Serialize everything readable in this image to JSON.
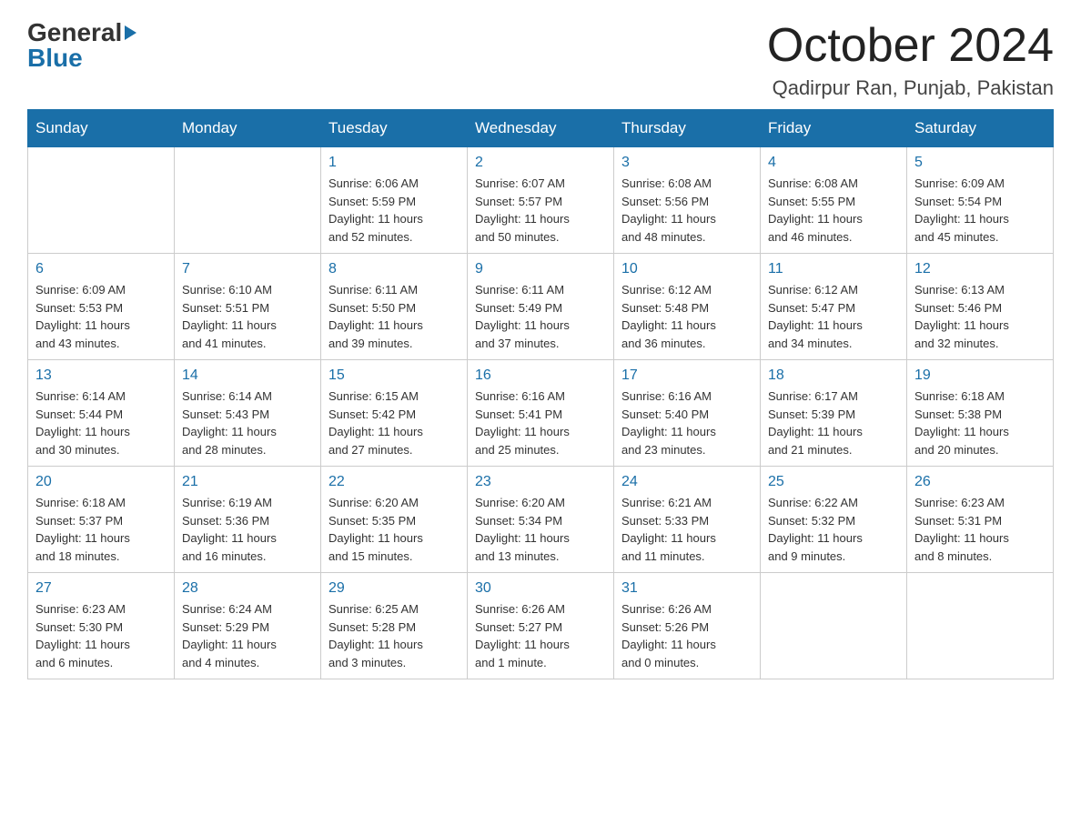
{
  "header": {
    "logo_general": "General",
    "logo_blue": "Blue",
    "month_title": "October 2024",
    "location": "Qadirpur Ran, Punjab, Pakistan"
  },
  "weekdays": [
    "Sunday",
    "Monday",
    "Tuesday",
    "Wednesday",
    "Thursday",
    "Friday",
    "Saturday"
  ],
  "weeks": [
    [
      {
        "day": "",
        "info": ""
      },
      {
        "day": "",
        "info": ""
      },
      {
        "day": "1",
        "info": "Sunrise: 6:06 AM\nSunset: 5:59 PM\nDaylight: 11 hours\nand 52 minutes."
      },
      {
        "day": "2",
        "info": "Sunrise: 6:07 AM\nSunset: 5:57 PM\nDaylight: 11 hours\nand 50 minutes."
      },
      {
        "day": "3",
        "info": "Sunrise: 6:08 AM\nSunset: 5:56 PM\nDaylight: 11 hours\nand 48 minutes."
      },
      {
        "day": "4",
        "info": "Sunrise: 6:08 AM\nSunset: 5:55 PM\nDaylight: 11 hours\nand 46 minutes."
      },
      {
        "day": "5",
        "info": "Sunrise: 6:09 AM\nSunset: 5:54 PM\nDaylight: 11 hours\nand 45 minutes."
      }
    ],
    [
      {
        "day": "6",
        "info": "Sunrise: 6:09 AM\nSunset: 5:53 PM\nDaylight: 11 hours\nand 43 minutes."
      },
      {
        "day": "7",
        "info": "Sunrise: 6:10 AM\nSunset: 5:51 PM\nDaylight: 11 hours\nand 41 minutes."
      },
      {
        "day": "8",
        "info": "Sunrise: 6:11 AM\nSunset: 5:50 PM\nDaylight: 11 hours\nand 39 minutes."
      },
      {
        "day": "9",
        "info": "Sunrise: 6:11 AM\nSunset: 5:49 PM\nDaylight: 11 hours\nand 37 minutes."
      },
      {
        "day": "10",
        "info": "Sunrise: 6:12 AM\nSunset: 5:48 PM\nDaylight: 11 hours\nand 36 minutes."
      },
      {
        "day": "11",
        "info": "Sunrise: 6:12 AM\nSunset: 5:47 PM\nDaylight: 11 hours\nand 34 minutes."
      },
      {
        "day": "12",
        "info": "Sunrise: 6:13 AM\nSunset: 5:46 PM\nDaylight: 11 hours\nand 32 minutes."
      }
    ],
    [
      {
        "day": "13",
        "info": "Sunrise: 6:14 AM\nSunset: 5:44 PM\nDaylight: 11 hours\nand 30 minutes."
      },
      {
        "day": "14",
        "info": "Sunrise: 6:14 AM\nSunset: 5:43 PM\nDaylight: 11 hours\nand 28 minutes."
      },
      {
        "day": "15",
        "info": "Sunrise: 6:15 AM\nSunset: 5:42 PM\nDaylight: 11 hours\nand 27 minutes."
      },
      {
        "day": "16",
        "info": "Sunrise: 6:16 AM\nSunset: 5:41 PM\nDaylight: 11 hours\nand 25 minutes."
      },
      {
        "day": "17",
        "info": "Sunrise: 6:16 AM\nSunset: 5:40 PM\nDaylight: 11 hours\nand 23 minutes."
      },
      {
        "day": "18",
        "info": "Sunrise: 6:17 AM\nSunset: 5:39 PM\nDaylight: 11 hours\nand 21 minutes."
      },
      {
        "day": "19",
        "info": "Sunrise: 6:18 AM\nSunset: 5:38 PM\nDaylight: 11 hours\nand 20 minutes."
      }
    ],
    [
      {
        "day": "20",
        "info": "Sunrise: 6:18 AM\nSunset: 5:37 PM\nDaylight: 11 hours\nand 18 minutes."
      },
      {
        "day": "21",
        "info": "Sunrise: 6:19 AM\nSunset: 5:36 PM\nDaylight: 11 hours\nand 16 minutes."
      },
      {
        "day": "22",
        "info": "Sunrise: 6:20 AM\nSunset: 5:35 PM\nDaylight: 11 hours\nand 15 minutes."
      },
      {
        "day": "23",
        "info": "Sunrise: 6:20 AM\nSunset: 5:34 PM\nDaylight: 11 hours\nand 13 minutes."
      },
      {
        "day": "24",
        "info": "Sunrise: 6:21 AM\nSunset: 5:33 PM\nDaylight: 11 hours\nand 11 minutes."
      },
      {
        "day": "25",
        "info": "Sunrise: 6:22 AM\nSunset: 5:32 PM\nDaylight: 11 hours\nand 9 minutes."
      },
      {
        "day": "26",
        "info": "Sunrise: 6:23 AM\nSunset: 5:31 PM\nDaylight: 11 hours\nand 8 minutes."
      }
    ],
    [
      {
        "day": "27",
        "info": "Sunrise: 6:23 AM\nSunset: 5:30 PM\nDaylight: 11 hours\nand 6 minutes."
      },
      {
        "day": "28",
        "info": "Sunrise: 6:24 AM\nSunset: 5:29 PM\nDaylight: 11 hours\nand 4 minutes."
      },
      {
        "day": "29",
        "info": "Sunrise: 6:25 AM\nSunset: 5:28 PM\nDaylight: 11 hours\nand 3 minutes."
      },
      {
        "day": "30",
        "info": "Sunrise: 6:26 AM\nSunset: 5:27 PM\nDaylight: 11 hours\nand 1 minute."
      },
      {
        "day": "31",
        "info": "Sunrise: 6:26 AM\nSunset: 5:26 PM\nDaylight: 11 hours\nand 0 minutes."
      },
      {
        "day": "",
        "info": ""
      },
      {
        "day": "",
        "info": ""
      }
    ]
  ]
}
